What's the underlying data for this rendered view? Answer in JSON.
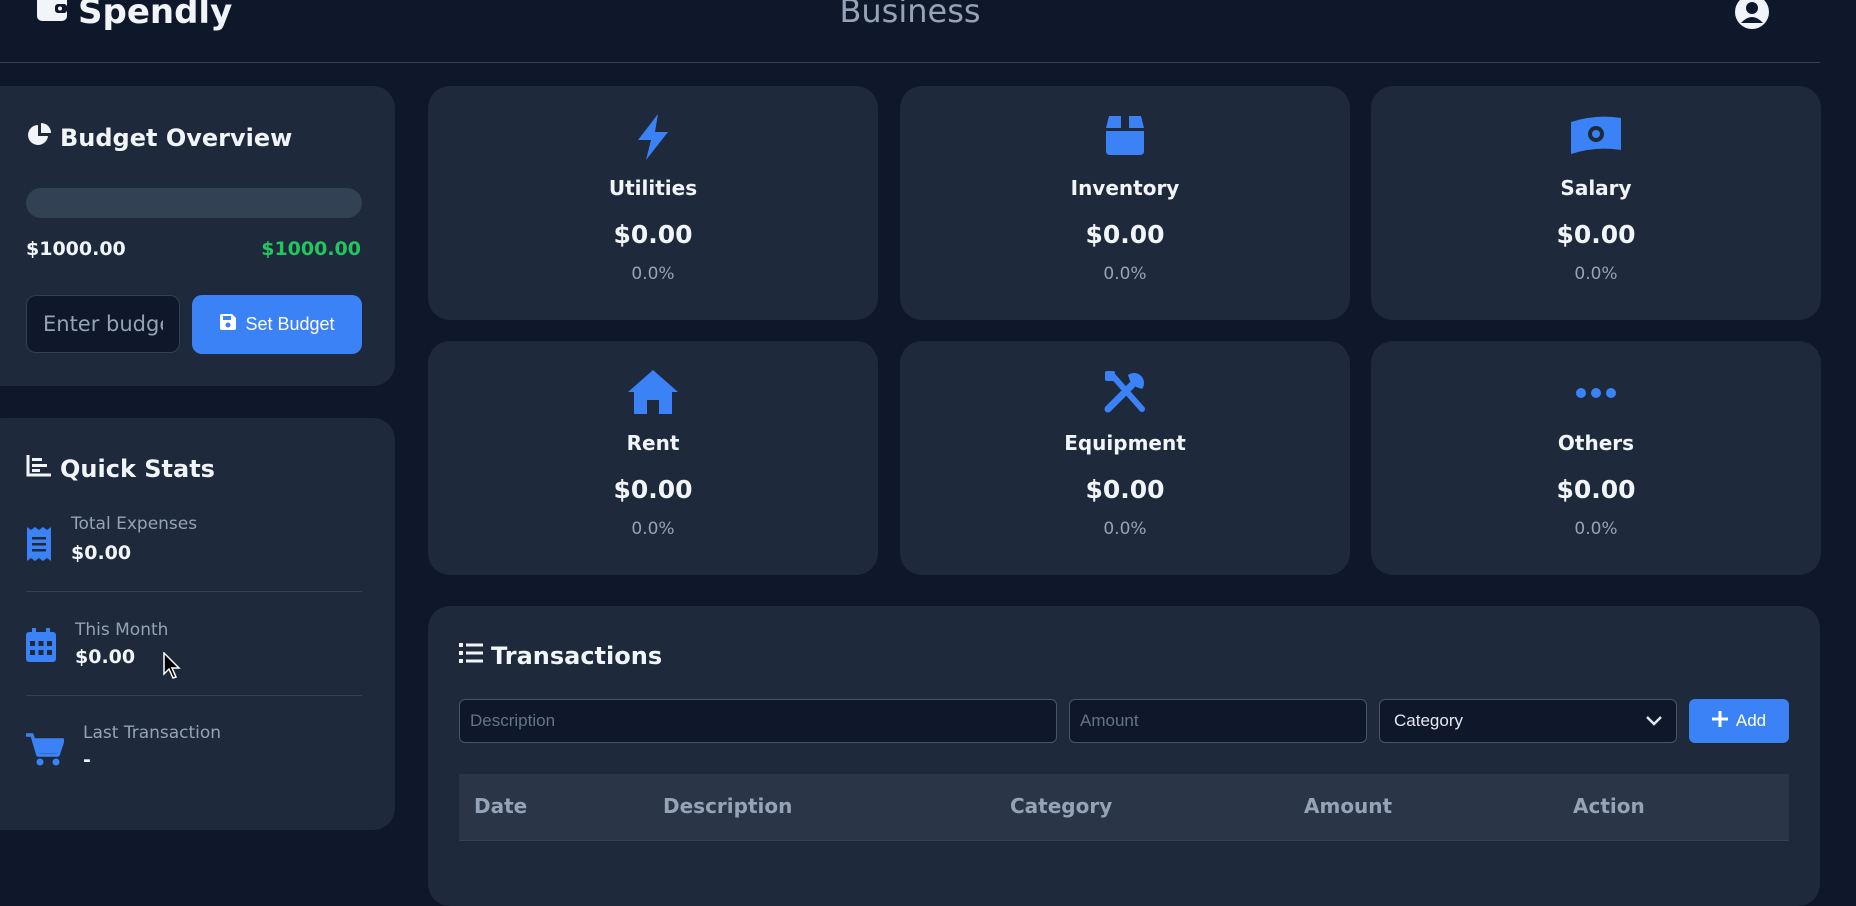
{
  "header": {
    "brand": "Spendly",
    "page_title": "Business"
  },
  "budget": {
    "title": "Budget Overview",
    "progress_fraction": 0,
    "spent_or_total": "$1000.00",
    "remaining": "$1000.00",
    "input_placeholder": "Enter budget",
    "set_button": "Set Budget",
    "remaining_color": "#22c55e"
  },
  "quick_stats": {
    "title": "Quick Stats",
    "items": [
      {
        "label": "Total Expenses",
        "value": "$0.00",
        "icon": "receipt-icon"
      },
      {
        "label": "This Month",
        "value": "$0.00",
        "icon": "calendar-icon"
      },
      {
        "label": "Last Transaction",
        "value": "-",
        "icon": "cart-icon"
      }
    ]
  },
  "categories": [
    {
      "name": "Utilities",
      "amount": "$0.00",
      "percent": "0.0%",
      "icon": "bolt-icon"
    },
    {
      "name": "Inventory",
      "amount": "$0.00",
      "percent": "0.0%",
      "icon": "box-icon"
    },
    {
      "name": "Salary",
      "amount": "$0.00",
      "percent": "0.0%",
      "icon": "money-bill-icon"
    },
    {
      "name": "Rent",
      "amount": "$0.00",
      "percent": "0.0%",
      "icon": "home-icon"
    },
    {
      "name": "Equipment",
      "amount": "$0.00",
      "percent": "0.0%",
      "icon": "tools-icon"
    },
    {
      "name": "Others",
      "amount": "$0.00",
      "percent": "0.0%",
      "icon": "ellipsis-icon"
    }
  ],
  "transactions": {
    "title": "Transactions",
    "description_placeholder": "Description",
    "amount_placeholder": "Amount",
    "category_selected": "Category",
    "add_button": "Add",
    "columns": [
      "Date",
      "Description",
      "Category",
      "Amount",
      "Action"
    ]
  },
  "colors": {
    "accent": "#3b82f6",
    "background": "#0f172a",
    "card": "#1e293b"
  }
}
